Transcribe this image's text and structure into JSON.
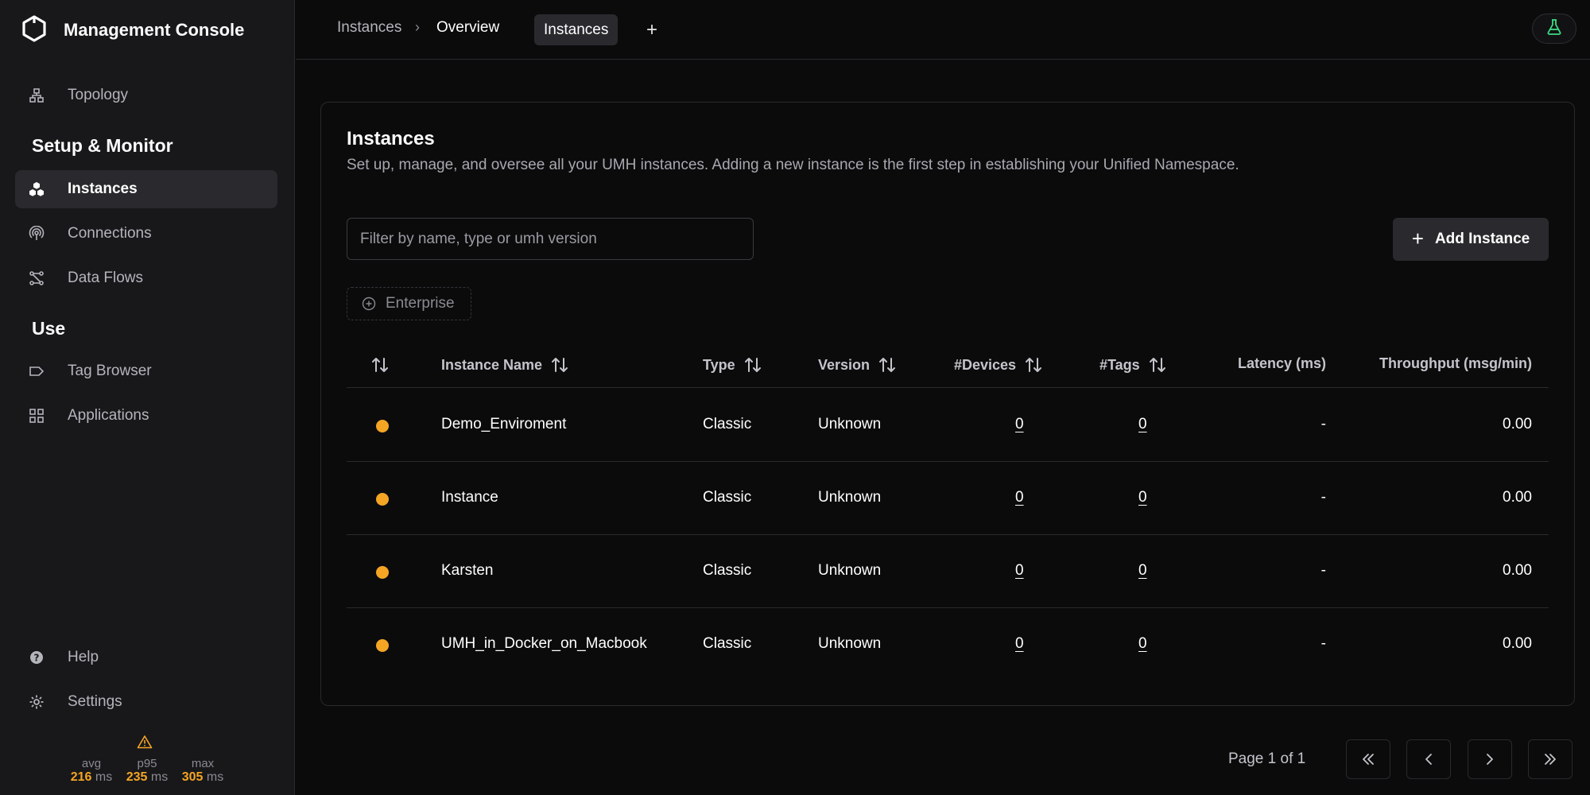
{
  "app": {
    "title": "Management Console"
  },
  "sidebar": {
    "topology": "Topology",
    "section1": "Setup & Monitor",
    "instances": "Instances",
    "connections": "Connections",
    "data_flows": "Data Flows",
    "section2": "Use",
    "tag_browser": "Tag Browser",
    "applications": "Applications",
    "help": "Help",
    "settings": "Settings"
  },
  "latency": {
    "avg_label": "avg",
    "avg_value": "216",
    "p95_label": "p95",
    "p95_value": "235",
    "max_label": "max",
    "max_value": "305",
    "unit": "ms",
    "value_color": "#f5a524"
  },
  "topbar": {
    "breadcrumb_root": "Instances",
    "breadcrumb_sep": "›",
    "breadcrumb_current": "Overview",
    "active_tab": "Instances",
    "add_tab": "+"
  },
  "card": {
    "title": "Instances",
    "description": "Set up, manage, and oversee all your UMH instances. Adding a new instance is the first step in establishing your Unified Namespace.",
    "filter_placeholder": "Filter by name, type or umh version",
    "add_button": "Add Instance",
    "enterprise_chip": "Enterprise"
  },
  "table": {
    "headers": {
      "name": "Instance Name",
      "type": "Type",
      "version": "Version",
      "devices": "#Devices",
      "tags": "#Tags",
      "latency": "Latency (ms)",
      "throughput": "Throughput (msg/min)"
    },
    "status_color": "#f5a524",
    "rows": [
      {
        "name": "Demo_Enviroment",
        "type": "Classic",
        "version": "Unknown",
        "devices": "0",
        "tags": "0",
        "latency": "-",
        "throughput": "0.00"
      },
      {
        "name": "Instance",
        "type": "Classic",
        "version": "Unknown",
        "devices": "0",
        "tags": "0",
        "latency": "-",
        "throughput": "0.00"
      },
      {
        "name": "Karsten",
        "type": "Classic",
        "version": "Unknown",
        "devices": "0",
        "tags": "0",
        "latency": "-",
        "throughput": "0.00"
      },
      {
        "name": "UMH_in_Docker_on_Macbook",
        "type": "Classic",
        "version": "Unknown",
        "devices": "0",
        "tags": "0",
        "latency": "-",
        "throughput": "0.00"
      }
    ]
  },
  "pagination": {
    "info": "Page 1 of 1"
  }
}
